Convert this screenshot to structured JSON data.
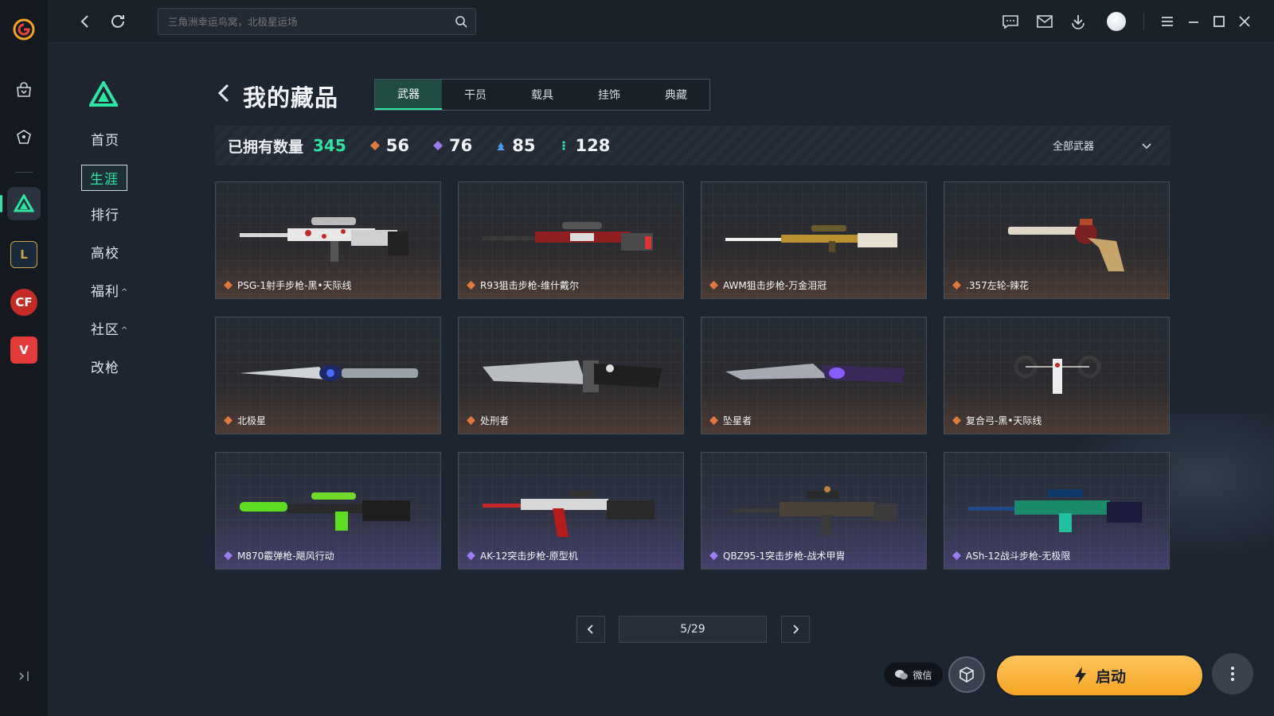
{
  "search": {
    "placeholder": "三角洲幸运鸟窝，北极星运场"
  },
  "sidebar": {
    "items": [
      {
        "label": "首页",
        "active": false,
        "caret": ""
      },
      {
        "label": "生涯",
        "active": true,
        "caret": ""
      },
      {
        "label": "排行",
        "active": false,
        "caret": ""
      },
      {
        "label": "高校",
        "active": false,
        "caret": ""
      },
      {
        "label": "福利",
        "active": false,
        "caret": "^"
      },
      {
        "label": "社区",
        "active": false,
        "caret": "^"
      },
      {
        "label": "改枪",
        "active": false,
        "caret": ""
      }
    ]
  },
  "rail": {
    "games": [
      "league-of-legends-icon",
      "crossfire-icon",
      "valorant-icon"
    ]
  },
  "page": {
    "title": "我的藏品",
    "tabs": [
      {
        "label": "武器",
        "active": true
      },
      {
        "label": "干员",
        "active": false
      },
      {
        "label": "载具",
        "active": false
      },
      {
        "label": "挂饰",
        "active": false
      },
      {
        "label": "典藏",
        "active": false
      }
    ]
  },
  "stats": {
    "owned_label": "已拥有数量",
    "owned_value": "345",
    "rarity": [
      {
        "value": "56",
        "color": "#e07a3c"
      },
      {
        "value": "76",
        "color": "#9d7cf0"
      },
      {
        "value": "85",
        "color": "#4a9be8"
      },
      {
        "value": "128",
        "color": "#2fe5a3"
      }
    ],
    "filter_label": "全部武器"
  },
  "items": [
    {
      "name": "PSG-1射手步枪-黑•天际线",
      "rarity": "orange",
      "gem_color": "#e07a3c"
    },
    {
      "name": "R93狙击步枪-维什戴尔",
      "rarity": "orange",
      "gem_color": "#e07a3c"
    },
    {
      "name": "AWM狙击步枪-万金泪冠",
      "rarity": "orange",
      "gem_color": "#e07a3c"
    },
    {
      "name": ".357左轮-辣花",
      "rarity": "orange",
      "gem_color": "#e07a3c"
    },
    {
      "name": "北极星",
      "rarity": "orange",
      "gem_color": "#e07a3c"
    },
    {
      "name": "处刑者",
      "rarity": "orange",
      "gem_color": "#e07a3c"
    },
    {
      "name": "坠星者",
      "rarity": "orange",
      "gem_color": "#e07a3c"
    },
    {
      "name": "复合弓-黑•天际线",
      "rarity": "orange",
      "gem_color": "#e07a3c"
    },
    {
      "name": "M870霰弹枪-飓风行动",
      "rarity": "purple",
      "gem_color": "#9d7cf0"
    },
    {
      "name": "AK-12突击步枪-原型机",
      "rarity": "purple",
      "gem_color": "#9d7cf0"
    },
    {
      "name": "QBZ95-1突击步枪-战术甲胄",
      "rarity": "purple",
      "gem_color": "#9d7cf0"
    },
    {
      "name": "ASh-12战斗步枪-无极限",
      "rarity": "purple",
      "gem_color": "#9d7cf0"
    }
  ],
  "pagination": {
    "display": "5/29"
  },
  "actions": {
    "wechat_label": "微信",
    "launch_label": "启动"
  },
  "colors": {
    "accent": "#2fe5a3",
    "launch": "#f5a524"
  }
}
